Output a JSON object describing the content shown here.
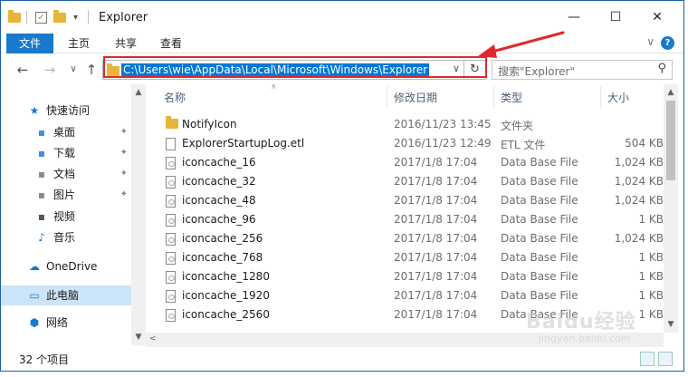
{
  "window": {
    "title": "Explorer",
    "controls": {
      "minimize": "—",
      "maximize": "☐",
      "close": "✕"
    }
  },
  "ribbon": {
    "tabs": [
      "文件",
      "主页",
      "共享",
      "查看"
    ],
    "collapse_glyph": "∨",
    "help_glyph": "?"
  },
  "address": {
    "path": "C:\\Users\\wie\\AppData\\Local\\Microsoft\\Windows\\Explorer",
    "dropdown_glyph": "∨",
    "refresh_glyph": "↻"
  },
  "nav": {
    "back": "←",
    "forward": "→",
    "recent": "∨",
    "up": "↑"
  },
  "search": {
    "placeholder": "搜索\"Explorer\"",
    "icon": "search-icon",
    "glyph": "⚲"
  },
  "sidebar": {
    "items": [
      {
        "label": "快速访问",
        "icon": "star-icon",
        "glyph": "★",
        "pinned": false
      },
      {
        "label": "桌面",
        "icon": "desktop-folder-icon",
        "glyph": "▪",
        "pinned": true
      },
      {
        "label": "下载",
        "icon": "download-folder-icon",
        "glyph": "▪",
        "pinned": true
      },
      {
        "label": "文档",
        "icon": "documents-icon",
        "glyph": "▪",
        "pinned": true
      },
      {
        "label": "图片",
        "icon": "pictures-icon",
        "glyph": "▪",
        "pinned": true
      },
      {
        "label": "视频",
        "icon": "videos-icon",
        "glyph": "▪",
        "pinned": false
      },
      {
        "label": "音乐",
        "icon": "music-icon",
        "glyph": "♪",
        "pinned": false
      },
      {
        "label": "OneDrive",
        "icon": "cloud-icon",
        "glyph": "☁",
        "pinned": false
      },
      {
        "label": "此电脑",
        "icon": "computer-icon",
        "glyph": "▭",
        "pinned": false
      },
      {
        "label": "网络",
        "icon": "network-icon",
        "glyph": "⬢",
        "pinned": false
      }
    ],
    "pin_glyph": "📌"
  },
  "columns": {
    "name": "名称",
    "date": "修改日期",
    "type": "类型",
    "size": "大小"
  },
  "files": [
    {
      "name": "NotifyIcon",
      "date": "2016/11/23 13:45",
      "type": "文件夹",
      "size": "",
      "kind": "folder"
    },
    {
      "name": "ExplorerStartupLog.etl",
      "date": "2016/11/23 12:49",
      "type": "ETL 文件",
      "size": "504 KB",
      "kind": "file"
    },
    {
      "name": "iconcache_16",
      "date": "2017/1/8 17:04",
      "type": "Data Base File",
      "size": "1,024 KB",
      "kind": "db"
    },
    {
      "name": "iconcache_32",
      "date": "2017/1/8 17:04",
      "type": "Data Base File",
      "size": "1,024 KB",
      "kind": "db"
    },
    {
      "name": "iconcache_48",
      "date": "2017/1/8 17:04",
      "type": "Data Base File",
      "size": "1,024 KB",
      "kind": "db"
    },
    {
      "name": "iconcache_96",
      "date": "2017/1/8 17:04",
      "type": "Data Base File",
      "size": "1 KB",
      "kind": "db"
    },
    {
      "name": "iconcache_256",
      "date": "2017/1/8 17:04",
      "type": "Data Base File",
      "size": "1,024 KB",
      "kind": "db"
    },
    {
      "name": "iconcache_768",
      "date": "2017/1/8 17:04",
      "type": "Data Base File",
      "size": "1 KB",
      "kind": "db"
    },
    {
      "name": "iconcache_1280",
      "date": "2017/1/8 17:04",
      "type": "Data Base File",
      "size": "1 KB",
      "kind": "db"
    },
    {
      "name": "iconcache_1920",
      "date": "2017/1/8 17:04",
      "type": "Data Base File",
      "size": "1 KB",
      "kind": "db"
    },
    {
      "name": "iconcache_2560",
      "date": "2017/1/8 17:04",
      "type": "Data Base File",
      "size": "1 KB",
      "kind": "db"
    }
  ],
  "status": {
    "count": "32 个项目"
  },
  "scroll_glyphs": {
    "up": "▲",
    "down": "▼",
    "left": "<"
  },
  "watermark": {
    "main": "Baidu经验",
    "sub": "jingyan.baidu.com"
  },
  "colors": {
    "accent": "#1979ca",
    "selection": "#0078d7",
    "annotation": "#e0282a",
    "folder": "#e9b43a"
  }
}
